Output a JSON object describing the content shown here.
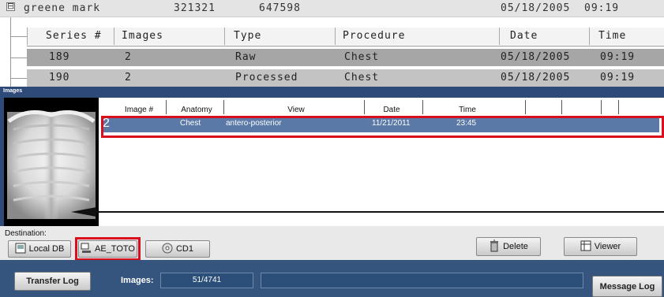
{
  "patient": {
    "expander": "⊟",
    "name": "greene mark",
    "patient_id": "321321",
    "accession": "647598",
    "date": "05/18/2005",
    "time": "09:19"
  },
  "series_table": {
    "columns": [
      "Series #",
      "Images",
      "Type",
      "Procedure",
      "Date",
      "Time"
    ],
    "rows": [
      {
        "series": "189",
        "images": "2",
        "type": "Raw",
        "procedure": "Chest",
        "date": "05/18/2005",
        "time": "09:19"
      },
      {
        "series": "190",
        "images": "2",
        "type": "Processed",
        "procedure": "Chest",
        "date": "05/18/2005",
        "time": "09:19"
      }
    ]
  },
  "images_panel": {
    "title": "Images",
    "columns": [
      "Image #",
      "Anatomy",
      "View",
      "Date",
      "Time"
    ],
    "selected_row": {
      "image": "2",
      "anatomy": "Chest",
      "view": "antero-posterior",
      "date": "11/21/2011",
      "time": "23:45"
    }
  },
  "destination": {
    "label": "Destination:",
    "targets": [
      "Local DB",
      "AE_TOTO",
      "CD1"
    ],
    "delete_label": "Delete",
    "viewer_label": "Viewer"
  },
  "status_bar": {
    "transfer_log_label": "Transfer Log",
    "images_label": "Images:",
    "images_count": "51/4741",
    "message_log_label": "Message Log"
  },
  "colors": {
    "highlight": "#d8101e",
    "panel": "#2e4a78",
    "selection": "#5a79a6"
  }
}
